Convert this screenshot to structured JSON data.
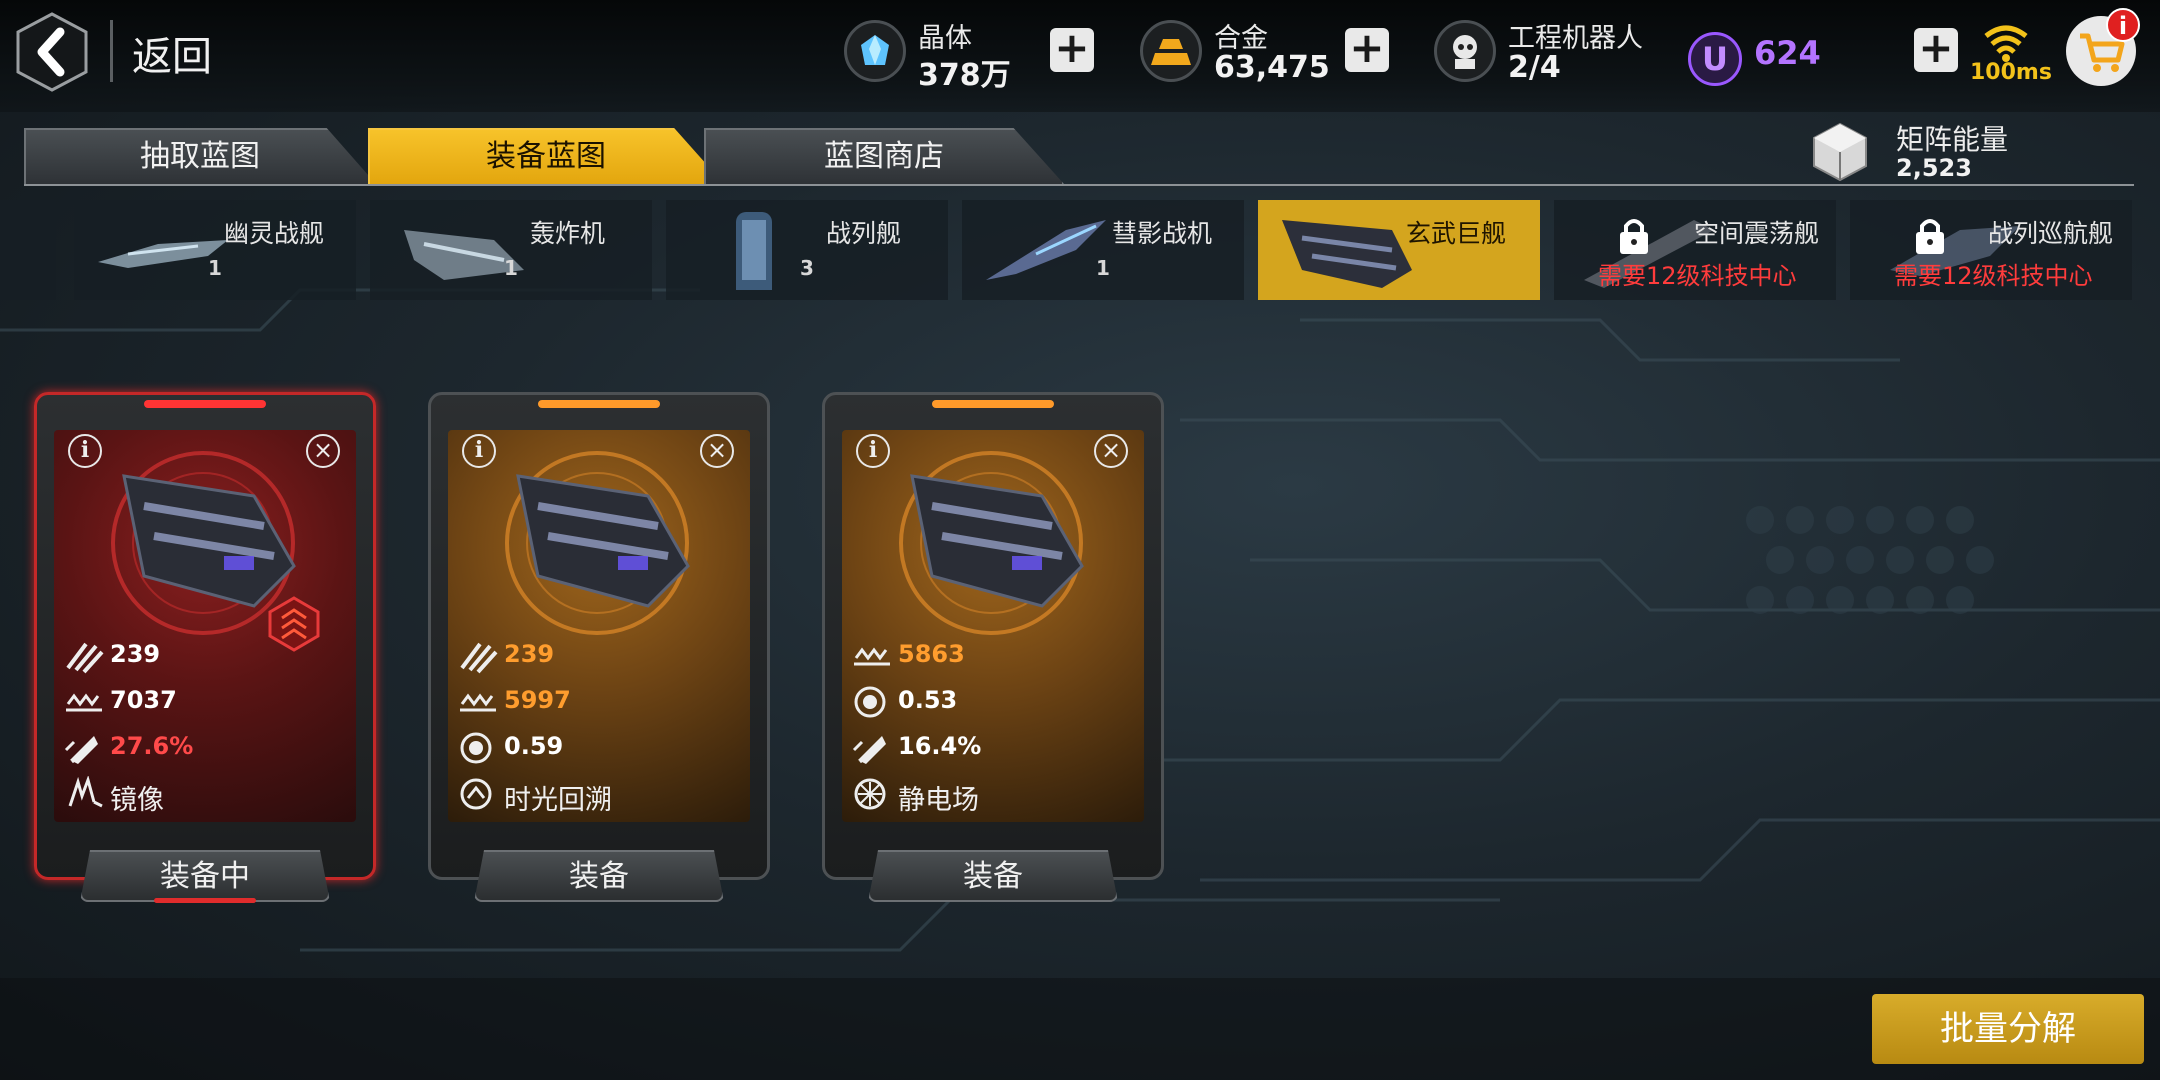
{
  "header": {
    "back_label": "返回",
    "resources": [
      {
        "name": "晶体",
        "value": "378万",
        "icon": "crystal-icon",
        "color": "#5ec4ff"
      },
      {
        "name": "合金",
        "value": "63,475",
        "icon": "alloy-icon",
        "color": "#f2a81c"
      },
      {
        "name": "工程机器人",
        "value": "2/4",
        "icon": "robot-icon",
        "color": "#e8e8e8"
      }
    ],
    "premium": {
      "symbol": "U",
      "value": "624",
      "color": "#b474ff"
    },
    "ping": "100ms",
    "cart_badge": "i"
  },
  "tabs": [
    {
      "label": "抽取蓝图",
      "active": false
    },
    {
      "label": "装备蓝图",
      "active": true
    },
    {
      "label": "蓝图商店",
      "active": false
    }
  ],
  "matrix_energy": {
    "name": "矩阵能量",
    "value": "2,523"
  },
  "ship_types": [
    {
      "name": "幽灵战舰",
      "count": "1",
      "locked": false,
      "active": false
    },
    {
      "name": "轰炸机",
      "count": "1",
      "locked": false,
      "active": false
    },
    {
      "name": "战列舰",
      "count": "3",
      "locked": false,
      "active": false
    },
    {
      "name": "彗影战机",
      "count": "1",
      "locked": false,
      "active": false
    },
    {
      "name": "玄武巨舰",
      "count": "",
      "locked": false,
      "active": true
    },
    {
      "name": "空间震荡舰",
      "count": "",
      "locked": true,
      "requirement": "需要12级科技中心",
      "active": false
    },
    {
      "name": "战列巡航舰",
      "count": "",
      "locked": true,
      "requirement": "需要12级科技中心",
      "active": false
    }
  ],
  "cards": [
    {
      "theme": "red",
      "stats": [
        "239",
        "7037",
        "27.6%"
      ],
      "stat_icons": [
        "damage-icon",
        "armor-icon",
        "speed-icon"
      ],
      "stat_colors": [
        "#ffffff",
        "#ffffff",
        "#ff4a4a"
      ],
      "skill": "镜像",
      "skill_icon": "mirror-icon",
      "button": "装备中",
      "equipped": true
    },
    {
      "theme": "orange",
      "stats": [
        "239",
        "5997",
        "0.59"
      ],
      "stat_icons": [
        "damage-icon",
        "armor-icon",
        "shield-icon"
      ],
      "stat_colors": [
        "#ff9d2e",
        "#ff9d2e",
        "#ffffff"
      ],
      "skill": "时光回溯",
      "skill_icon": "time-rewind-icon",
      "button": "装备",
      "equipped": false
    },
    {
      "theme": "orange",
      "stats": [
        "5863",
        "0.53",
        "16.4%"
      ],
      "stat_icons": [
        "armor-icon",
        "shield-icon",
        "speed-icon"
      ],
      "stat_colors": [
        "#ff9d2e",
        "#ffffff",
        "#ffffff"
      ],
      "skill": "静电场",
      "skill_icon": "static-field-icon",
      "button": "装备",
      "equipped": false
    }
  ],
  "batch_button": "批量分解"
}
